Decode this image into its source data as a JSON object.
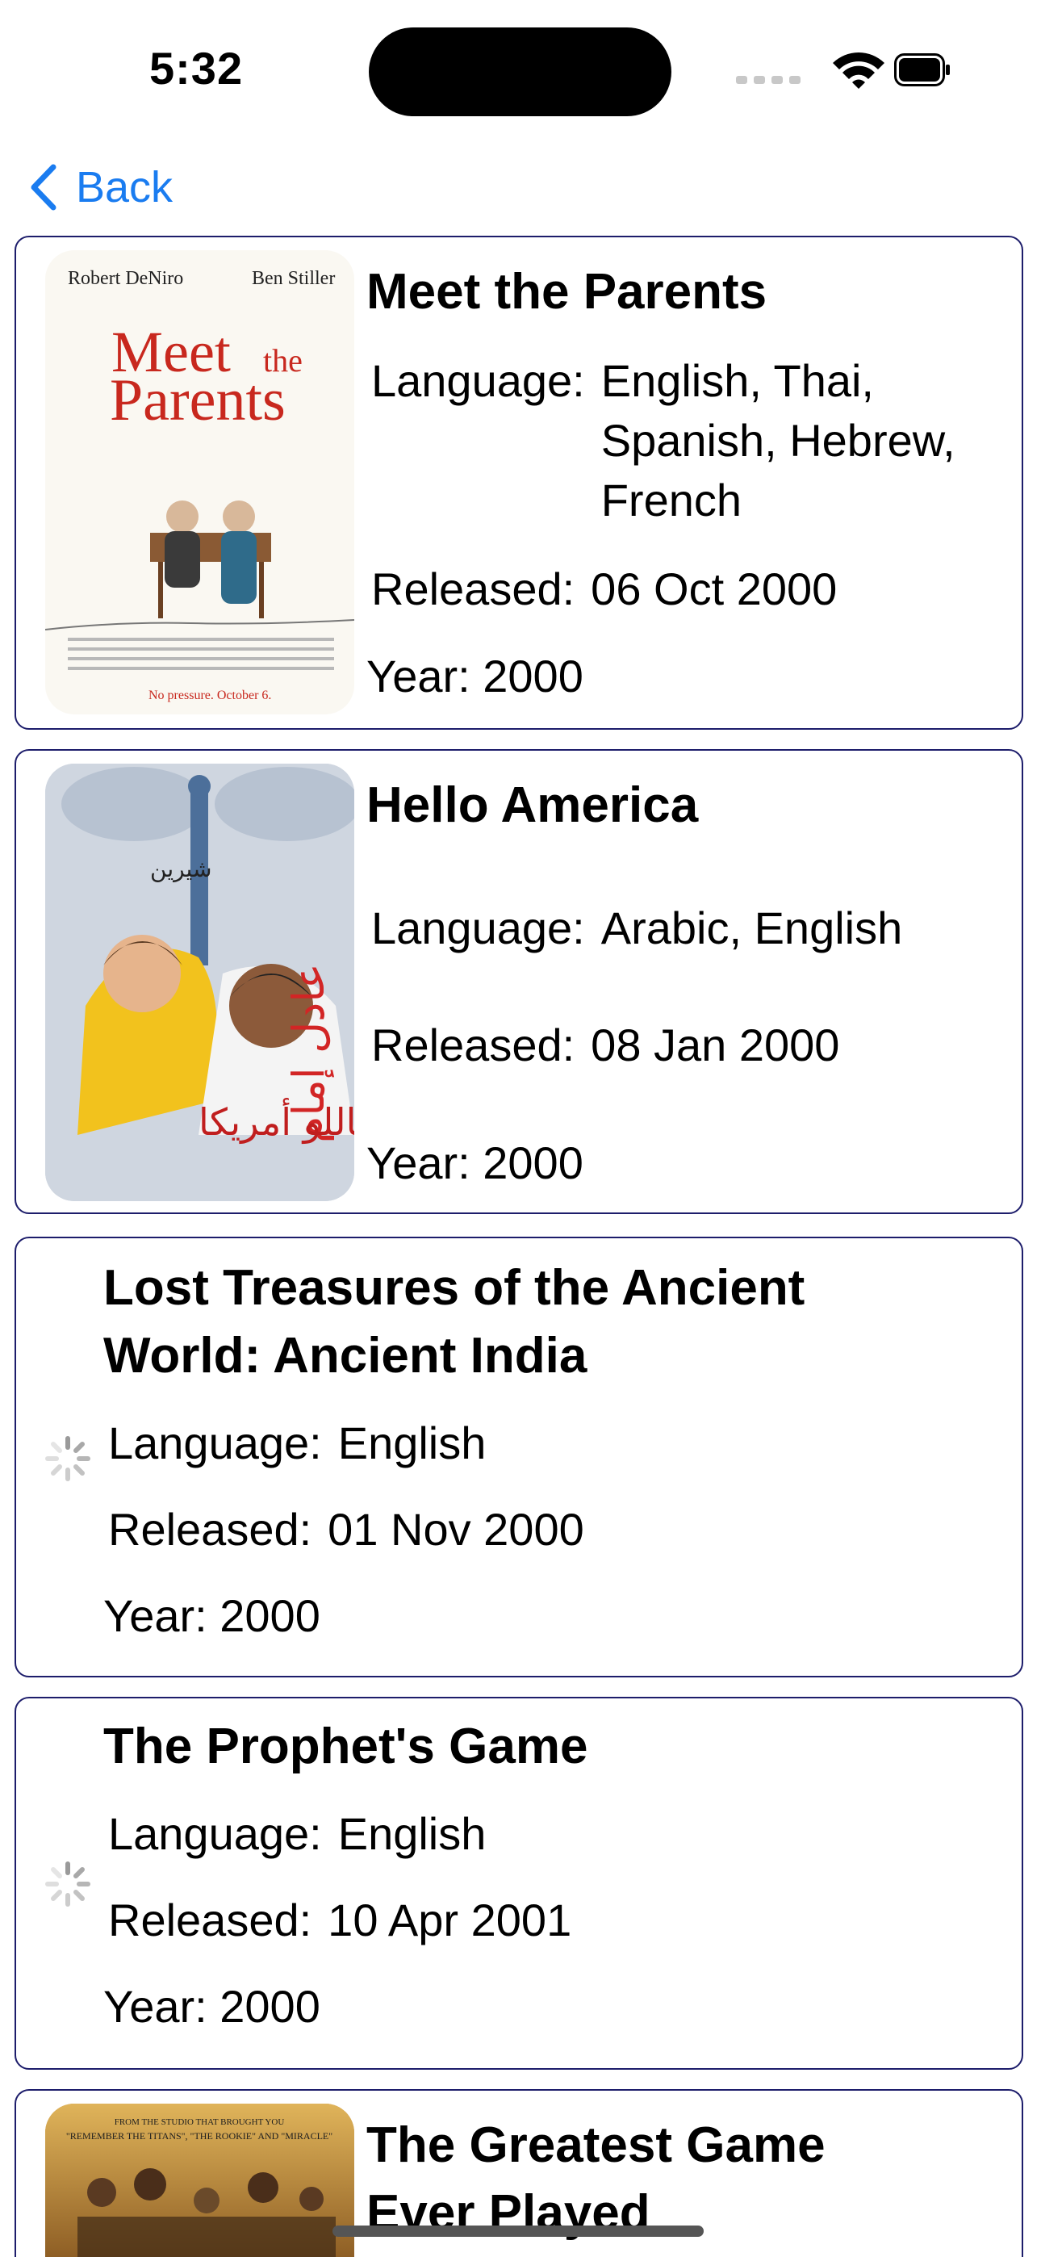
{
  "status": {
    "time": "5:32"
  },
  "nav": {
    "back_label": "Back"
  },
  "movies": [
    {
      "title": "Meet the Parents",
      "language_label": "Language:",
      "language": "English, Thai, Spanish, Hebrew, French",
      "released_label": "Released:",
      "released": "06 Oct 2000",
      "year": "Year: 2000",
      "poster": {
        "actor_left": "Robert DeNiro",
        "actor_right": "Ben Stiller",
        "title_line1": "Meet",
        "title_the": "the",
        "title_line2": "Parents",
        "tagline": "No pressure. October 6."
      }
    },
    {
      "title": "Hello America",
      "language_label": "Language:",
      "language": "Arabic, English",
      "released_label": "Released:",
      "released": "08 Jan 2000",
      "year": "Year: 2000",
      "poster": {
        "arabic_title": "هاللو أمريكا",
        "arabic_name": "عادل إمام",
        "arabic_costar": "شيرين"
      }
    },
    {
      "title": "Lost Treasures of the Ancient World: Ancient India",
      "language_label": "Language:",
      "language": "English",
      "released_label": "Released:",
      "released": "01 Nov 2000",
      "year": "Year: 2000"
    },
    {
      "title": "The Prophet's Game",
      "language_label": "Language:",
      "language": "English",
      "released_label": "Released:",
      "released": "10 Apr 2001",
      "year": "Year: 2000"
    },
    {
      "title": "The Greatest Game Ever Played",
      "poster": {
        "studio_line": "FROM THE STUDIO THAT BROUGHT YOU",
        "studio_films": "\"REMEMBER THE TITANS\", \"THE ROOKIE\" AND \"MIRACLE\""
      }
    }
  ],
  "colors": {
    "accent": "#1a7cf0",
    "card_border": "#1d1d6b"
  }
}
